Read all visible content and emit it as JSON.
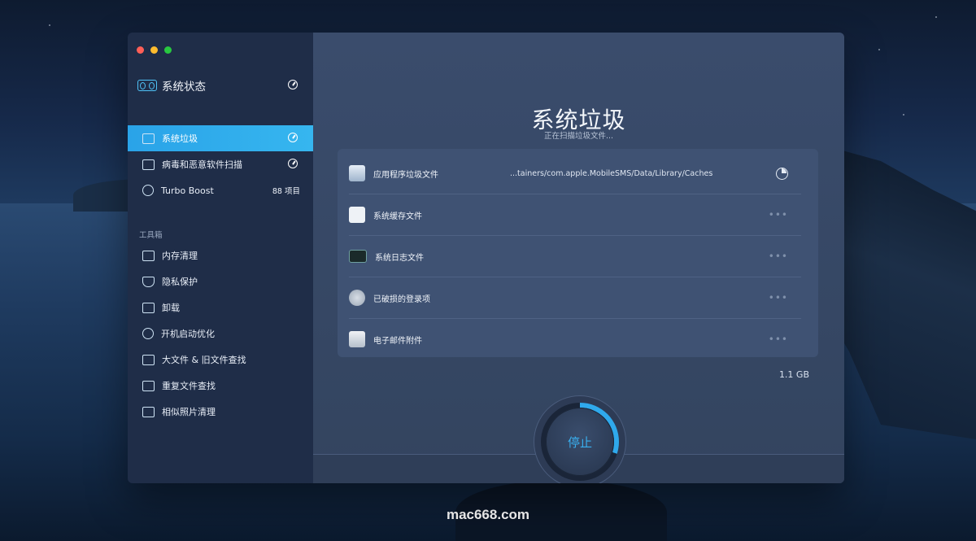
{
  "watermark": "mac668.com",
  "sidebar": {
    "status": {
      "label": "系统状态"
    },
    "items": [
      {
        "label": "系统垃圾",
        "active": true,
        "right": ""
      },
      {
        "label": "病毒和恶意软件扫描",
        "active": false,
        "right": ""
      },
      {
        "label": "Turbo Boost",
        "active": false,
        "right": "88 项目"
      }
    ],
    "toolbox_label": "工具箱",
    "tools": [
      {
        "label": "内存清理",
        "icon": "memory-icon"
      },
      {
        "label": "隐私保护",
        "icon": "shield-icon"
      },
      {
        "label": "卸载",
        "icon": "trash-icon"
      },
      {
        "label": "开机启动优化",
        "icon": "power-icon"
      },
      {
        "label": "大文件 & 旧文件查找",
        "icon": "files-icon"
      },
      {
        "label": "重复文件查找",
        "icon": "duplicate-icon"
      },
      {
        "label": "相似照片清理",
        "icon": "photo-icon"
      }
    ]
  },
  "main": {
    "title": "系统垃圾",
    "subtitle": "正在扫描垃圾文件...",
    "rows": [
      {
        "label": "应用程序垃圾文件",
        "path": "...tainers/com.apple.MobileSMS/Data/Library/Caches",
        "state": "scanning",
        "icon": "app-trash-icon"
      },
      {
        "label": "系统缓存文件",
        "path": "",
        "state": "pending",
        "more": "•••",
        "icon": "document-icon"
      },
      {
        "label": "系统日志文件",
        "path": "",
        "state": "pending",
        "more": "•••",
        "icon": "log-icon"
      },
      {
        "label": "已破损的登录项",
        "path": "",
        "state": "pending",
        "more": "•••",
        "icon": "power-icon"
      },
      {
        "label": "电子邮件附件",
        "path": "",
        "state": "pending",
        "more": "•••",
        "icon": "attachment-icon"
      }
    ],
    "total_size": "1.1 GB",
    "stop_label": "停止",
    "scan_progress": 0.3
  },
  "colors": {
    "accent": "#2fa9ec",
    "sidebar_bg": "#1f2d48",
    "main_bg": "#3a4c6c"
  }
}
